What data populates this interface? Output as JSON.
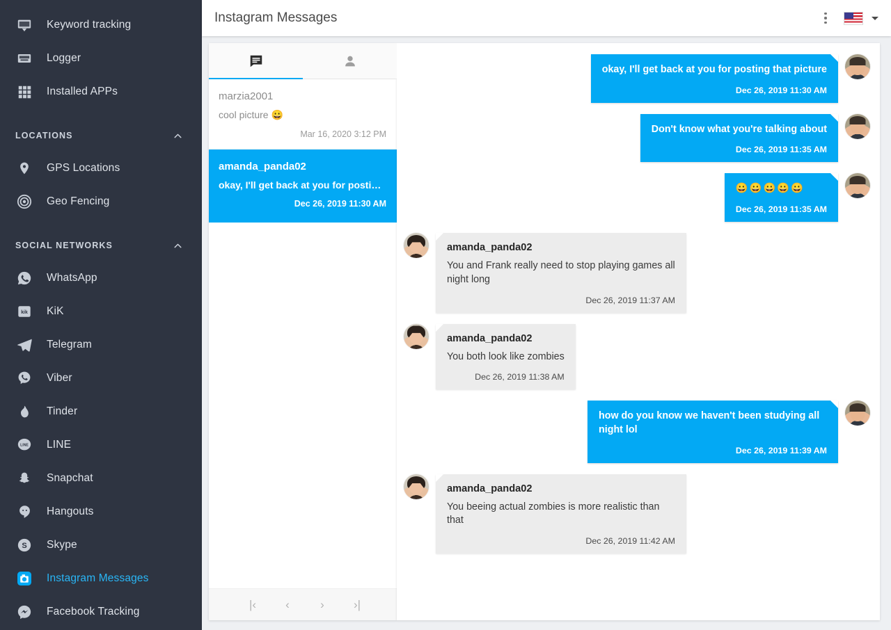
{
  "sidebar": {
    "top_items": [
      {
        "label": "Keyword tracking",
        "icon": "keyboard-tracking-icon",
        "active": false
      },
      {
        "label": "Logger",
        "icon": "keyboard-logger-icon",
        "active": false
      },
      {
        "label": "Installed APPs",
        "icon": "grid-apps-icon",
        "active": false
      }
    ],
    "groups": [
      {
        "title": "LOCATIONS",
        "chevron": "chevron-up-icon",
        "items": [
          {
            "label": "GPS Locations",
            "icon": "map-pin-icon",
            "active": false
          },
          {
            "label": "Geo Fencing",
            "icon": "target-circles-icon",
            "active": false
          }
        ]
      },
      {
        "title": "SOCIAL NETWORKS",
        "chevron": "chevron-up-icon",
        "items": [
          {
            "label": "WhatsApp",
            "icon": "whatsapp-icon",
            "active": false
          },
          {
            "label": "KiK",
            "icon": "kik-icon",
            "active": false
          },
          {
            "label": "Telegram",
            "icon": "telegram-icon",
            "active": false
          },
          {
            "label": "Viber",
            "icon": "viber-icon",
            "active": false
          },
          {
            "label": "Tinder",
            "icon": "tinder-flame-icon",
            "active": false
          },
          {
            "label": "LINE",
            "icon": "line-icon",
            "active": false
          },
          {
            "label": "Snapchat",
            "icon": "snapchat-ghost-icon",
            "active": false
          },
          {
            "label": "Hangouts",
            "icon": "hangouts-icon",
            "active": false
          },
          {
            "label": "Skype",
            "icon": "skype-icon",
            "active": false
          },
          {
            "label": "Instagram Messages",
            "icon": "instagram-icon",
            "active": true
          },
          {
            "label": "Facebook Tracking",
            "icon": "messenger-icon",
            "active": false
          }
        ]
      }
    ]
  },
  "topbar": {
    "title": "Instagram Messages",
    "menu_icon": "kebab-menu-icon",
    "flag_icon": "us-flag-icon",
    "caret_icon": "chevron-down-icon"
  },
  "list_panel": {
    "tabs": [
      {
        "name": "messages-tab",
        "icon": "chat-bubble-icon",
        "active": true
      },
      {
        "name": "contacts-tab",
        "icon": "person-icon",
        "active": false
      }
    ],
    "conversations": [
      {
        "name": "marzia2001",
        "preview": "cool picture 😀",
        "time": "Mar 16, 2020 3:12 PM",
        "selected": false
      },
      {
        "name": "amanda_panda02",
        "preview": "okay, I'll get back at you for posting tha…",
        "time": "Dec 26, 2019 11:30 AM",
        "selected": true
      }
    ],
    "pager": [
      {
        "name": "first-page-button",
        "glyph": "|‹"
      },
      {
        "name": "prev-page-button",
        "glyph": "‹"
      },
      {
        "name": "next-page-button",
        "glyph": "›"
      },
      {
        "name": "last-page-button",
        "glyph": "›|"
      }
    ]
  },
  "chat": {
    "messages": [
      {
        "direction": "out",
        "sender": "",
        "text": "okay, I'll get back at you for posting that picture",
        "time": "Dec 26, 2019 11:30 AM",
        "avatar": "male"
      },
      {
        "direction": "out",
        "sender": "",
        "text": "Don't know what you're talking about",
        "time": "Dec 26, 2019 11:35 AM",
        "avatar": "male"
      },
      {
        "direction": "out",
        "sender": "",
        "text": "😀😀😀😀😀",
        "time": "Dec 26, 2019 11:35 AM",
        "avatar": "male",
        "emoji": true
      },
      {
        "direction": "in",
        "sender": "amanda_panda02",
        "text": "You and Frank really need to stop playing games all night long",
        "time": "Dec 26, 2019 11:37 AM",
        "avatar": "female"
      },
      {
        "direction": "in",
        "sender": "amanda_panda02",
        "text": "You both look like zombies",
        "time": "Dec 26, 2019 11:38 AM",
        "avatar": "female"
      },
      {
        "direction": "out",
        "sender": "",
        "text": "how do you know we haven't been studying all night lol",
        "time": "Dec 26, 2019 11:39 AM",
        "avatar": "male"
      },
      {
        "direction": "in",
        "sender": "amanda_panda02",
        "text": "You beeing actual zombies is more realistic than that",
        "time": "Dec 26, 2019 11:42 AM",
        "avatar": "female"
      }
    ]
  },
  "colors": {
    "sidebar_bg": "#2e3441",
    "accent": "#03a9f4",
    "incoming_bubble": "#ececec",
    "page_bg": "#eef0f3"
  }
}
